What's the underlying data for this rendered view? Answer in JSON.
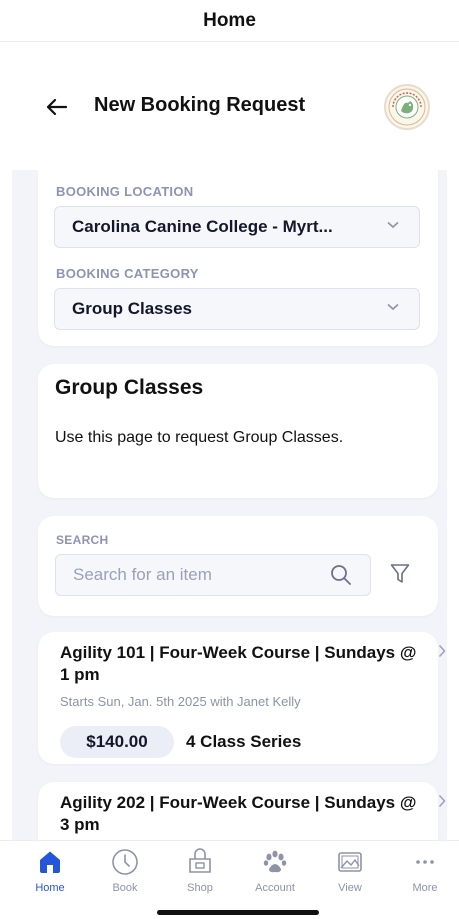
{
  "topbar": {
    "title": "Home"
  },
  "header": {
    "title": "New Booking Request",
    "logo_text": "CAROLINA CANINE COLLEGE"
  },
  "booking": {
    "location_label": "BOOKING LOCATION",
    "location_value": "Carolina Canine College - Myrt...",
    "category_label": "BOOKING CATEGORY",
    "category_value": "Group Classes"
  },
  "info": {
    "title": "Group Classes",
    "description": "Use this page to request Group Classes."
  },
  "search": {
    "label": "SEARCH",
    "placeholder": "Search for an item"
  },
  "items": [
    {
      "title": "Agility 101 | Four-Week Course | Sundays @ 1 pm",
      "subtitle": "Starts Sun, Jan. 5th 2025 with Janet Kelly",
      "price": "$140.00",
      "series": "4 Class Series"
    },
    {
      "title": "Agility 202 | Four-Week Course | Sundays @ 3 pm"
    }
  ],
  "tabs": [
    {
      "label": "Home",
      "icon": "home-icon",
      "active": true
    },
    {
      "label": "Book",
      "icon": "clock-icon"
    },
    {
      "label": "Shop",
      "icon": "shop-icon"
    },
    {
      "label": "Account",
      "icon": "paw-icon"
    },
    {
      "label": "View",
      "icon": "image-icon"
    },
    {
      "label": "More",
      "icon": "more-icon"
    }
  ],
  "colors": {
    "accent": "#2356d8",
    "label": "#8d93b3",
    "background": "#f3f3fa"
  }
}
